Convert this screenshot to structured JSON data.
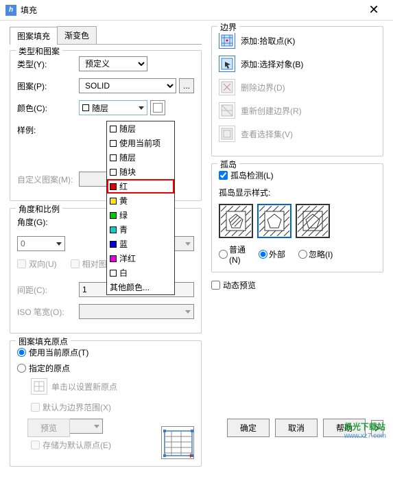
{
  "window": {
    "title": "填充"
  },
  "tabs": {
    "pattern_fill": "图案填充",
    "gradient": "渐变色"
  },
  "type_pattern": {
    "title": "类型和图案",
    "type_label": "类型(Y):",
    "type_value": "预定义",
    "pattern_label": "图案(P):",
    "pattern_value": "SOLID",
    "color_label": "颜色(C):",
    "color_value": "随层",
    "sample_label": "样例:",
    "custom_label": "自定义图案(M):"
  },
  "color_dropdown": {
    "items": [
      {
        "color": "#fff",
        "label": "随层",
        "empty": true
      },
      {
        "color": "#fff",
        "label": "使用当前项",
        "empty": true
      },
      {
        "color": "#fff",
        "label": "随层",
        "empty": true
      },
      {
        "color": "#fff",
        "label": "随块",
        "empty": true
      },
      {
        "color": "#e00000",
        "label": "红",
        "highlight": true
      },
      {
        "color": "#ffe600",
        "label": "黄"
      },
      {
        "color": "#00c800",
        "label": "绿"
      },
      {
        "color": "#00d0d0",
        "label": "青"
      },
      {
        "color": "#0000e0",
        "label": "蓝"
      },
      {
        "color": "#e000e0",
        "label": "洋红"
      },
      {
        "color": "#fff",
        "label": "白",
        "empty": true
      }
    ],
    "other": "其他颜色..."
  },
  "angle_scale": {
    "title": "角度和比例",
    "angle_label": "角度(G):",
    "angle_value": "0",
    "bidir": "双向(U)",
    "relative": "相对图纸空间(E)",
    "spacing_label": "间距(C):",
    "spacing_value": "1",
    "iso_label": "ISO 笔宽(O):"
  },
  "origin": {
    "title": "图案填充原点",
    "use_current": "使用当前原点(T)",
    "specified": "指定的原点",
    "click_set": "单击以设置新原点",
    "default_boundary": "默认为边界范围(X)",
    "position": "左下",
    "store_default": "存储为默认原点(E)"
  },
  "boundary": {
    "title": "边界",
    "add_pick": "添加:拾取点(K)",
    "add_select": "添加:选择对象(B)",
    "delete": "删除边界(D)",
    "recreate": "重新创建边界(R)",
    "view_selection": "查看选择集(V)"
  },
  "island": {
    "title": "孤岛",
    "detect": "孤岛检测(L)",
    "display_label": "孤岛显示样式:",
    "normal": "普通(N)",
    "outer": "外部",
    "ignore": "忽略(I)"
  },
  "dynamic_preview": "动态预览",
  "footer": {
    "preview": "预览",
    "ok": "确定",
    "cancel": "取消",
    "help": "帮助"
  },
  "watermark": {
    "top": "极光下载站",
    "bot": "www.xz7.com"
  }
}
